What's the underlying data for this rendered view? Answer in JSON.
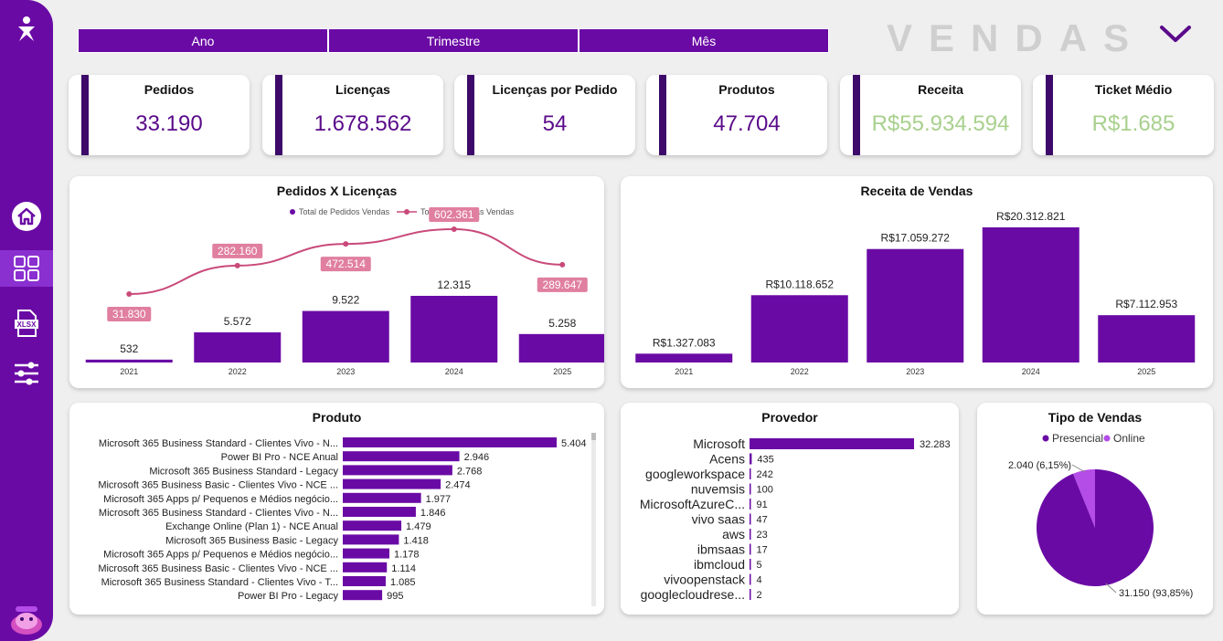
{
  "tabs": [
    "Ano",
    "Trimestre",
    "Mês"
  ],
  "header": {
    "title": "VENDAS"
  },
  "kpis": [
    {
      "label": "Pedidos",
      "value": "33.190",
      "color": "#5a0a8a"
    },
    {
      "label": "Licenças",
      "value": "1.678.562",
      "color": "#5a0a8a"
    },
    {
      "label": "Licenças por Pedido",
      "value": "54",
      "color": "#5a0a8a"
    },
    {
      "label": "Produtos",
      "value": "47.704",
      "color": "#5a0a8a"
    },
    {
      "label": "Receita",
      "value": "R$55.934.594",
      "color": "#a8d08d"
    },
    {
      "label": "Ticket Médio",
      "value": "R$1.685",
      "color": "#a8d08d"
    }
  ],
  "sidebar": {
    "icons": [
      "person-logo-icon",
      "home-icon",
      "dashboard-icon",
      "xlsx-icon",
      "sliders-icon",
      "mascot-logo-icon"
    ]
  },
  "chart_data": [
    {
      "type": "bar",
      "title": "Pedidos X Licenças",
      "categories": [
        "2021",
        "2022",
        "2023",
        "2024",
        "2025"
      ],
      "series": [
        {
          "name": "Total de Pedidos Vendas",
          "values": [
            532,
            5572,
            9522,
            12315,
            5258
          ],
          "labels": [
            "532",
            "5.572",
            "9.522",
            "12.315",
            "5.258"
          ],
          "color": "#6a0aa5"
        },
        {
          "name": "Total de Licenças Vendas",
          "values": [
            31830,
            282160,
            472514,
            602361,
            289647
          ],
          "labels": [
            "31.830",
            "282.160",
            "472.514",
            "602.361",
            "289.647"
          ],
          "color": "#c94a7a"
        }
      ]
    },
    {
      "type": "bar",
      "title": "Receita de Vendas",
      "categories": [
        "2021",
        "2022",
        "2023",
        "2024",
        "2025"
      ],
      "values": [
        1327083,
        10118652,
        17059272,
        20312821,
        7112953
      ],
      "labels": [
        "R$1.327.083",
        "R$10.118.652",
        "R$17.059.272",
        "R$20.312.821",
        "R$7.112.953"
      ]
    },
    {
      "type": "bar",
      "title": "Produto",
      "categories": [
        "Microsoft 365 Business Standard - Clientes Vivo - N...",
        "Power BI Pro - NCE Anual",
        "Microsoft 365 Business Standard - Legacy",
        "Microsoft 365 Business Basic - Clientes Vivo - NCE ...",
        "Microsoft 365 Apps p/ Pequenos e Médios negócio...",
        "Microsoft 365 Business Standard - Clientes Vivo - N...",
        "Exchange Online (Plan 1) - NCE Anual",
        "Microsoft 365 Business Basic - Legacy",
        "Microsoft 365 Apps p/ Pequenos e Médios negócio...",
        "Microsoft 365 Business Basic - Clientes Vivo - NCE ...",
        "Microsoft 365 Business Standard - Clientes Vivo - T...",
        "Power BI Pro - Legacy"
      ],
      "values": [
        5404,
        2946,
        2768,
        2474,
        1977,
        1846,
        1479,
        1418,
        1178,
        1114,
        1085,
        995
      ],
      "labels": [
        "5.404",
        "2.946",
        "2.768",
        "2.474",
        "1.977",
        "1.846",
        "1.479",
        "1.418",
        "1.178",
        "1.114",
        "1.085",
        "995"
      ]
    },
    {
      "type": "bar",
      "title": "Provedor",
      "categories": [
        "Microsoft",
        "Acens",
        "googleworkspace",
        "nuvemsis",
        "MicrosoftAzureC...",
        "vivo saas",
        "aws",
        "ibmsaas",
        "ibmcloud",
        "vivoopenstack",
        "googlecloudrese..."
      ],
      "values": [
        32283,
        435,
        242,
        100,
        91,
        47,
        23,
        17,
        5,
        4,
        2
      ],
      "labels": [
        "32.283",
        "435",
        "242",
        "100",
        "91",
        "47",
        "23",
        "17",
        "5",
        "4",
        "2"
      ]
    },
    {
      "type": "pie",
      "title": "Tipo de Vendas",
      "series": [
        {
          "name": "Presencial",
          "value": 31150,
          "label": "31.150 (93,85%)",
          "color": "#6a0aa5"
        },
        {
          "name": "Online",
          "value": 2040,
          "label": "2.040 (6,15%)",
          "color": "#b44ce8"
        }
      ]
    }
  ]
}
